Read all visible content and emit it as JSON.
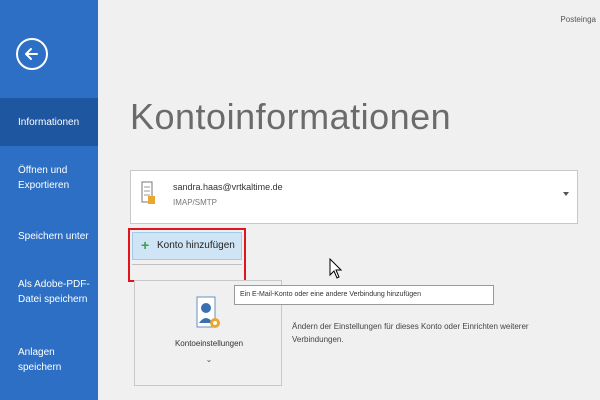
{
  "header": {
    "topright_text": "Posteinga"
  },
  "sidebar": {
    "items": [
      {
        "label": "Informationen",
        "active": true
      },
      {
        "label": "Öffnen und Exportieren"
      },
      {
        "label": "Speichern unter"
      },
      {
        "label": "Als Adobe-PDF-Datei speichern"
      },
      {
        "label": "Anlagen speichern"
      }
    ]
  },
  "main": {
    "title": "Kontoinformationen",
    "account": {
      "email": "sandra.haas@vrtkaltime.de",
      "type": "IMAP/SMTP"
    },
    "add_account": {
      "label": "Konto hinzufügen"
    },
    "tooltip": "Ein E-Mail-Konto oder eine andere Verbindung hinzufügen",
    "settings_tile": {
      "label": "Kontoeinstellungen",
      "caret": "⌄"
    },
    "settings_description": "Ändern der Einstellungen für dieses Konto oder Einrichten weiterer Verbindungen."
  },
  "colors": {
    "sidebar": "#2c6fc4",
    "sidebar_active": "#1f56a0",
    "highlight_border": "#e0141d",
    "add_button_bg": "#cfe4f5"
  }
}
